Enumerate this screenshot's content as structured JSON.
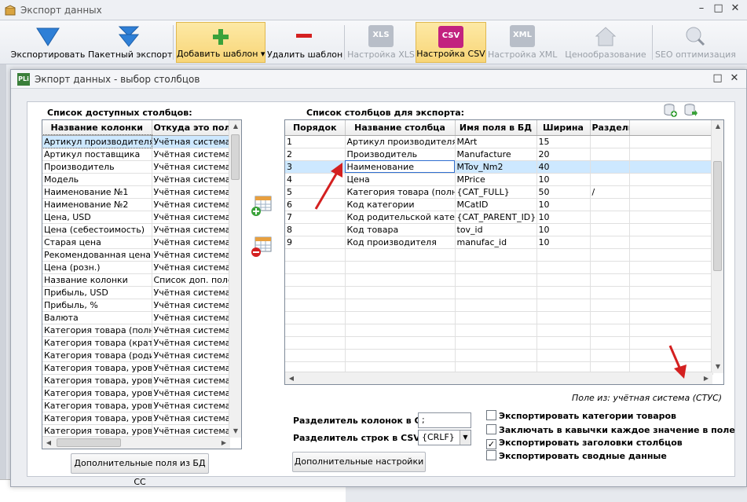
{
  "app": {
    "title": "Экспорт данных",
    "controls": [
      "–",
      "□",
      "✕"
    ]
  },
  "toolbar": {
    "export": "Экспортировать",
    "batch_export": "Пакетный экспорт",
    "add_template": "Добавить шаблон ▾",
    "delete_template": "Удалить шаблон",
    "xls_settings": "Настройка XLS",
    "csv_settings": "Настройка CSV",
    "xml_settings": "Настройка XML",
    "pricing": "Ценообразование",
    "seo": "SEO оптимизация",
    "xls_badge": "XLS",
    "csv_badge": "CSV",
    "xml_badge": "XML"
  },
  "dialog": {
    "title": "Экпорт данных - выбор столбцов",
    "icon_text": "PLi",
    "controls": [
      "□",
      "✕"
    ]
  },
  "left": {
    "title": "Список доступных столбцов:",
    "headers": [
      "Название колонки",
      "Откуда это пол"
    ],
    "rows": [
      [
        "Артикул производителя",
        "Учётная система"
      ],
      [
        "Артикул поставщика",
        "Учётная система"
      ],
      [
        "Производитель",
        "Учётная система"
      ],
      [
        "Модель",
        "Учётная система"
      ],
      [
        "Наименование №1",
        "Учётная система"
      ],
      [
        "Наименование №2",
        "Учётная система"
      ],
      [
        "Цена, USD",
        "Учётная система"
      ],
      [
        "Цена (себестоимость)",
        "Учётная система"
      ],
      [
        "Старая цена",
        "Учётная система"
      ],
      [
        "Рекомендованная цена",
        "Учётная система"
      ],
      [
        "Цена (розн.)",
        "Учётная система"
      ],
      [
        "Название колонки",
        "Список доп. полей"
      ],
      [
        "Прибыль, USD",
        "Учётная система"
      ],
      [
        "Прибыль, %",
        "Учётная система"
      ],
      [
        "Валюта",
        "Учётная система"
      ],
      [
        "Категория товара (полная)",
        "Учётная система"
      ],
      [
        "Категория товара (краткая)",
        "Учётная система"
      ],
      [
        "Категория товара (родитель)",
        "Учётная система"
      ],
      [
        "Категория товара, уровень",
        "Учётная система"
      ],
      [
        "Категория товара, уровень",
        "Учётная система"
      ],
      [
        "Категория товара, уровень",
        "Учётная система"
      ],
      [
        "Категория товара, уровень",
        "Учётная система"
      ],
      [
        "Категория товара, уровень",
        "Учётная система"
      ],
      [
        "Категория товара, уровень",
        "Учётная система"
      ]
    ],
    "extra_button": "Дополнительные поля из БД СС"
  },
  "right": {
    "title": "Список столбцов для экспорта:",
    "headers": [
      "Порядок",
      "Название столбца",
      "Имя поля в БД",
      "Ширина",
      "Раздели"
    ],
    "rows": [
      [
        "1",
        "Артикул производителя",
        "MArt",
        "15",
        ""
      ],
      [
        "2",
        "Производитель",
        "Manufacture",
        "20",
        ""
      ],
      [
        "3",
        "Наименование",
        "MTov_Nm2",
        "40",
        ""
      ],
      [
        "4",
        "Цена",
        "MPrice",
        "10",
        ""
      ],
      [
        "5",
        "Категория товара (полная)",
        "{CAT_FULL}",
        "50",
        "/"
      ],
      [
        "6",
        "Код категории",
        "MCatID",
        "10",
        ""
      ],
      [
        "7",
        "Код родительской категории",
        "{CAT_PARENT_ID}",
        "10",
        ""
      ],
      [
        "8",
        "Код товара",
        "tov_id",
        "10",
        ""
      ],
      [
        "9",
        "Код производителя",
        "manufac_id",
        "10",
        ""
      ]
    ],
    "selected_row": 2,
    "field_from": "Поле из:   учётная система (СТУС)"
  },
  "csv": {
    "col_sep_label": "Разделитель колонок в CSV:",
    "col_sep_value": ";",
    "row_sep_label": "Разделитель строк в CSV:",
    "row_sep_value": "{CRLF}",
    "extra_settings": "Дополнительные настройки"
  },
  "options": [
    {
      "label": "Экспортировать категории товаров",
      "checked": false
    },
    {
      "label": "Заключать в кавычки каждое значение в поле",
      "checked": false
    },
    {
      "label": "Экспортировать заголовки столбцов",
      "checked": true
    },
    {
      "label": "Экспортировать сводные данные",
      "checked": false
    }
  ],
  "colors": {
    "arrow_red": "#d42020",
    "csv_active_bg": "#f8d577",
    "selection": "#cde8ff"
  }
}
